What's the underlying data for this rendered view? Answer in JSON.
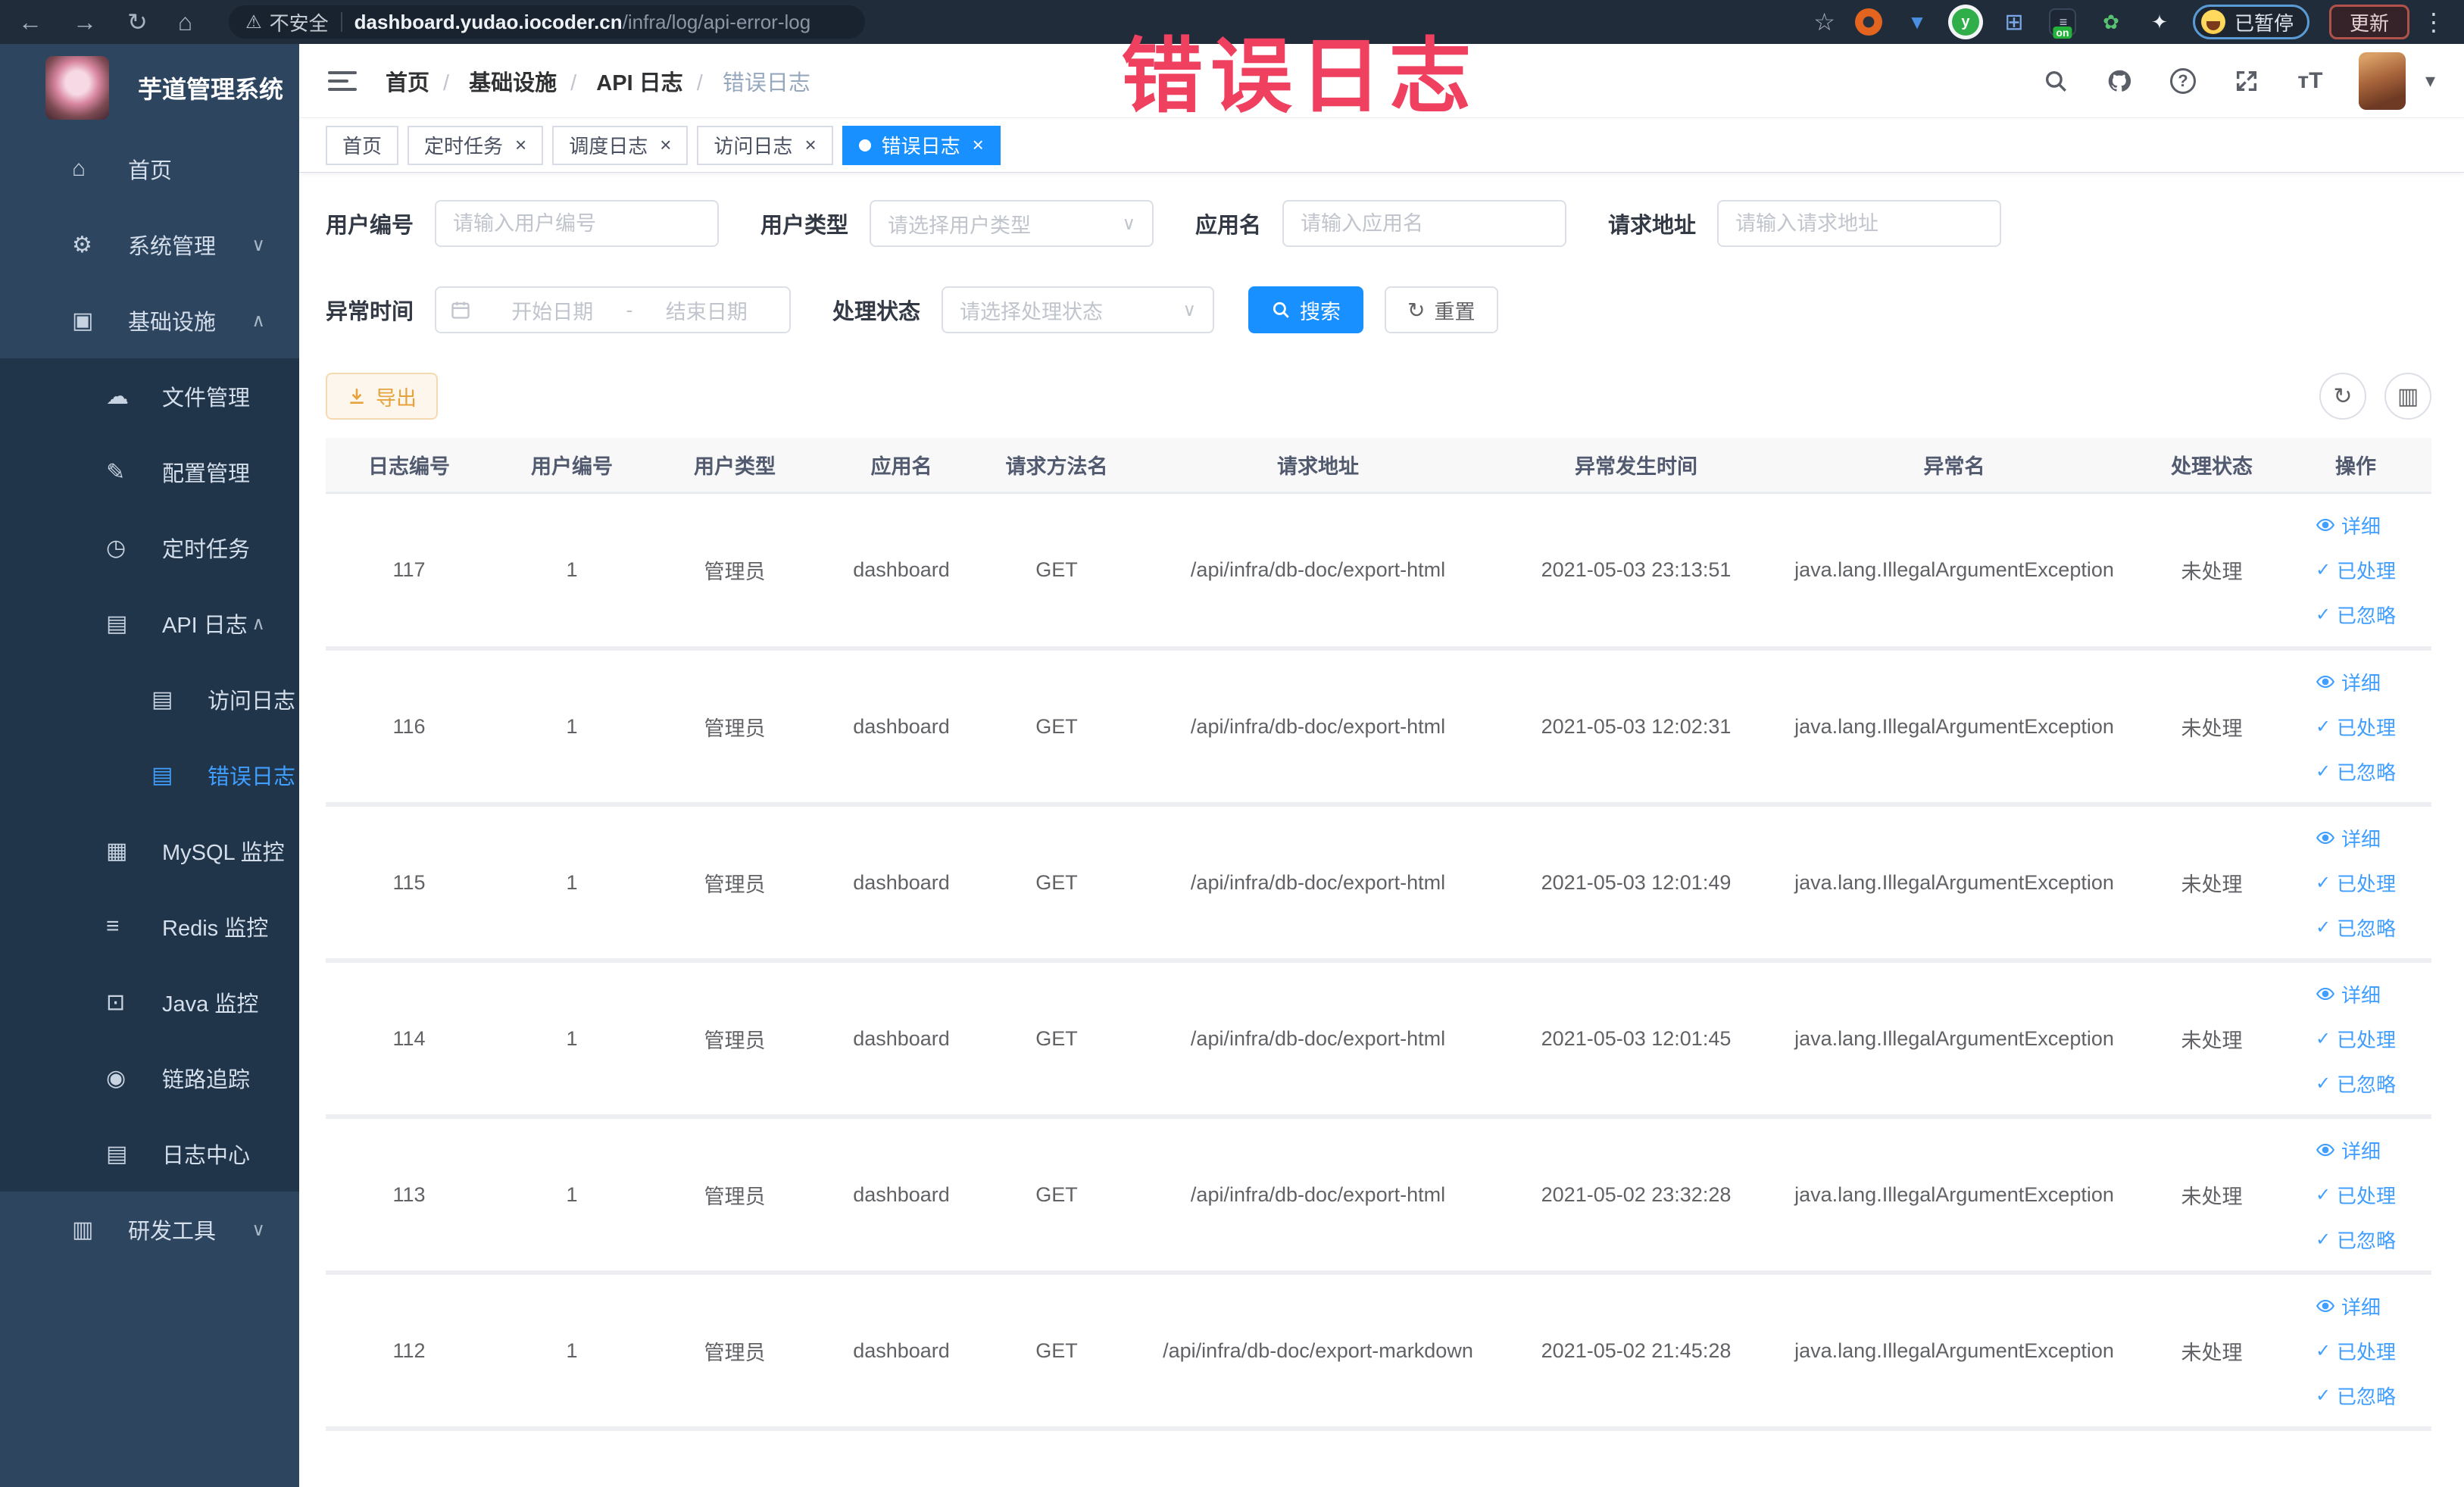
{
  "annotation": {
    "text": "错误日志",
    "color": "#f0405f"
  },
  "icons": {
    "back": "←",
    "forward": "→",
    "reload": "↻",
    "home": "⌂",
    "warning": "⚠",
    "star": "☆",
    "dots": "⋮",
    "caret": "▾",
    "check": "✓",
    "close": "×",
    "select_arrow": "∨",
    "refresh": "↻",
    "column_settings": "▥",
    "grid_ext": "⊞",
    "leaf_ext": "✿",
    "shield_ext": "▼",
    "puzzle_ext": "✦",
    "toggle_bars": "≡"
  },
  "browser": {
    "security_label": "不安全",
    "url_host": "dashboard.yudao.iocoder.cn",
    "url_path": "/infra/log/api-error-log",
    "ext_y": "y",
    "ext_on": "on",
    "paused_label": "已暂停",
    "update_label": "更新"
  },
  "sidebar": {
    "app_title": "芋道管理系统",
    "colors": {
      "bg": "#2e4560",
      "submenu_bg": "#20344a",
      "active": "#409eff"
    },
    "items": [
      {
        "glyph": "⌂",
        "label": "首页",
        "level": 0
      },
      {
        "glyph": "⚙",
        "label": "系统管理",
        "level": 0,
        "chevron": "∨"
      },
      {
        "glyph": "▣",
        "label": "基础设施",
        "level": 0,
        "chevron": "∧"
      },
      {
        "glyph": "☁",
        "label": "文件管理",
        "level": 1,
        "dark": true
      },
      {
        "glyph": "✎",
        "label": "配置管理",
        "level": 1,
        "dark": true
      },
      {
        "glyph": "◷",
        "label": "定时任务",
        "level": 1,
        "dark": true
      },
      {
        "glyph": "▤",
        "label": "API 日志",
        "level": 1,
        "dark": true,
        "chevron": "∧"
      },
      {
        "glyph": "▤",
        "label": "访问日志",
        "level": 2,
        "dark": true
      },
      {
        "glyph": "▤",
        "label": "错误日志",
        "level": 2,
        "dark": true,
        "active": true
      },
      {
        "glyph": "▦",
        "label": "MySQL 监控",
        "level": 1,
        "dark": true
      },
      {
        "glyph": "≡",
        "label": "Redis 监控",
        "level": 1,
        "dark": true
      },
      {
        "glyph": "⊡",
        "label": "Java 监控",
        "level": 1,
        "dark": true
      },
      {
        "glyph": "◉",
        "label": "链路追踪",
        "level": 1,
        "dark": true
      },
      {
        "glyph": "▤",
        "label": "日志中心",
        "level": 1,
        "dark": true
      },
      {
        "glyph": "▥",
        "label": "研发工具",
        "level": 0,
        "chevron": "∨"
      }
    ]
  },
  "header": {
    "breadcrumb": [
      {
        "label": "首页"
      },
      {
        "label": "基础设施",
        "sep": "/"
      },
      {
        "label": "API 日志",
        "sep": "/"
      },
      {
        "label": "错误日志",
        "sep": "/"
      }
    ],
    "fontsize_glyph": "тT"
  },
  "tabs": [
    {
      "label": "首页"
    },
    {
      "label": "定时任务",
      "closable": true
    },
    {
      "label": "调度日志",
      "closable": true
    },
    {
      "label": "访问日志",
      "closable": true
    },
    {
      "label": "错误日志",
      "closable": true,
      "active": true
    }
  ],
  "filters": {
    "user_id": {
      "label": "用户编号",
      "placeholder": "请输入用户编号"
    },
    "user_type": {
      "label": "用户类型",
      "placeholder": "请选择用户类型"
    },
    "app_name": {
      "label": "应用名",
      "placeholder": "请输入应用名"
    },
    "request_url": {
      "label": "请求地址",
      "placeholder": "请输入请求地址"
    },
    "exception_time": {
      "label": "异常时间",
      "start": "开始日期",
      "separator": "-",
      "end": "结束日期"
    },
    "process_status": {
      "label": "处理状态",
      "placeholder": "请选择处理状态"
    },
    "search_label": "搜索",
    "reset_label": "重置"
  },
  "toolbar": {
    "export_label": "导出"
  },
  "table": {
    "columns": [
      "日志编号",
      "用户编号",
      "用户类型",
      "应用名",
      "请求方法名",
      "请求地址",
      "异常发生时间",
      "异常名",
      "处理状态",
      "操作"
    ],
    "actions": {
      "detail": "详细",
      "processed": "已处理",
      "ignored": "已忽略"
    },
    "rows": [
      {
        "log_id": "117",
        "user_id": "1",
        "user_type": "管理员",
        "app_name": "dashboard",
        "method": "GET",
        "url": "/api/infra/db-doc/export-html",
        "time": "2021-05-03 23:13:51",
        "exception": "java.lang.IllegalArgumentException",
        "status": "未处理"
      },
      {
        "log_id": "116",
        "user_id": "1",
        "user_type": "管理员",
        "app_name": "dashboard",
        "method": "GET",
        "url": "/api/infra/db-doc/export-html",
        "time": "2021-05-03 12:02:31",
        "exception": "java.lang.IllegalArgumentException",
        "status": "未处理"
      },
      {
        "log_id": "115",
        "user_id": "1",
        "user_type": "管理员",
        "app_name": "dashboard",
        "method": "GET",
        "url": "/api/infra/db-doc/export-html",
        "time": "2021-05-03 12:01:49",
        "exception": "java.lang.IllegalArgumentException",
        "status": "未处理"
      },
      {
        "log_id": "114",
        "user_id": "1",
        "user_type": "管理员",
        "app_name": "dashboard",
        "method": "GET",
        "url": "/api/infra/db-doc/export-html",
        "time": "2021-05-03 12:01:45",
        "exception": "java.lang.IllegalArgumentException",
        "status": "未处理"
      },
      {
        "log_id": "113",
        "user_id": "1",
        "user_type": "管理员",
        "app_name": "dashboard",
        "method": "GET",
        "url": "/api/infra/db-doc/export-html",
        "time": "2021-05-02 23:32:28",
        "exception": "java.lang.IllegalArgumentException",
        "status": "未处理"
      },
      {
        "log_id": "112",
        "user_id": "1",
        "user_type": "管理员",
        "app_name": "dashboard",
        "method": "GET",
        "url": "/api/infra/db-doc/export-markdown",
        "time": "2021-05-02 21:45:28",
        "exception": "java.lang.IllegalArgumentException",
        "status": "未处理"
      }
    ]
  }
}
